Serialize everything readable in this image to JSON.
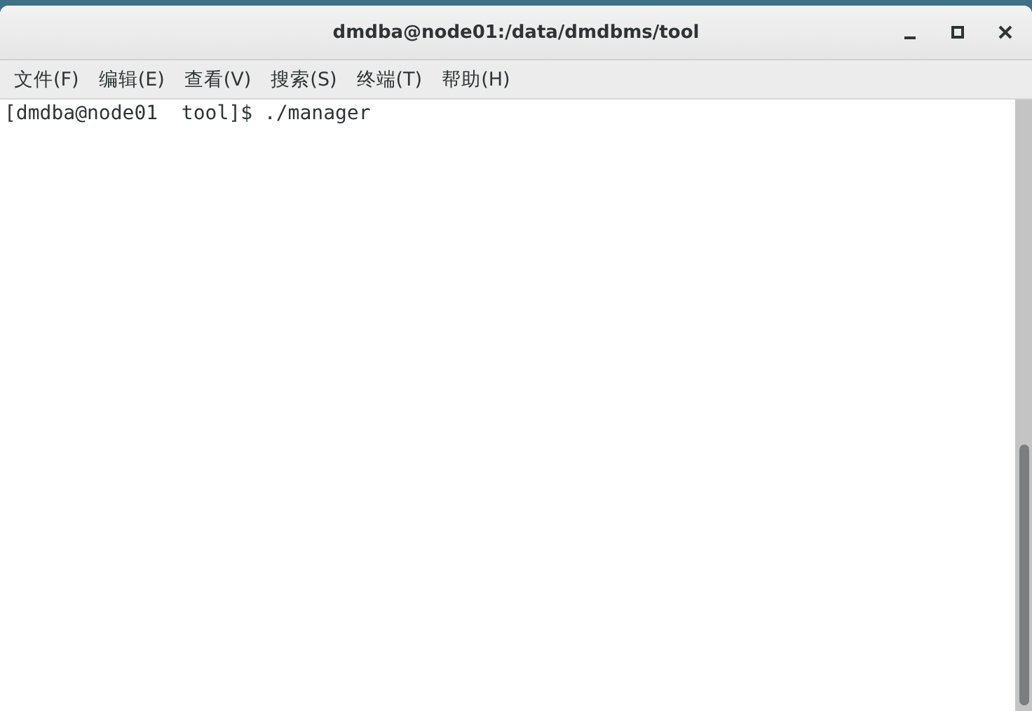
{
  "window": {
    "title": "dmdba@node01:/data/dmdbms/tool"
  },
  "menu": [
    {
      "label": "文件(F)"
    },
    {
      "label": "编辑(E)"
    },
    {
      "label": "查看(V)"
    },
    {
      "label": "搜索(S)"
    },
    {
      "label": "终端(T)"
    },
    {
      "label": "帮助(H)"
    }
  ],
  "terminal": {
    "lines": [
      "[dmdba@node01  tool]$ ./manager"
    ]
  }
}
